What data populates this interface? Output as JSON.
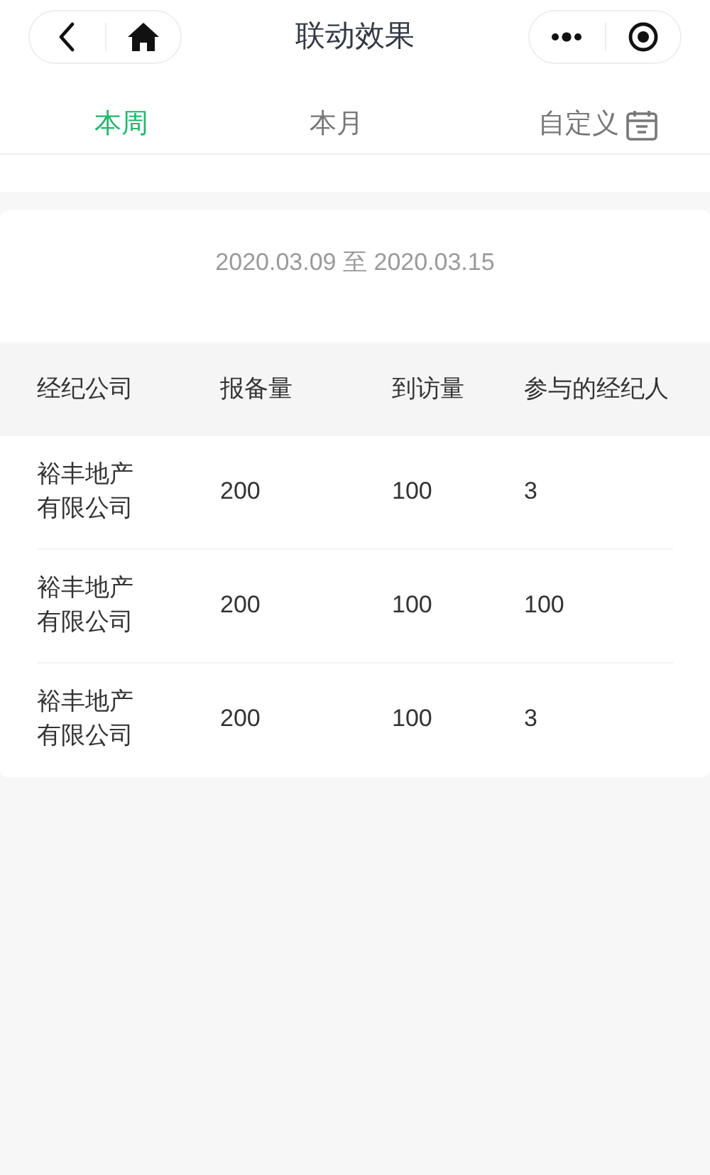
{
  "nav": {
    "title": "联动效果"
  },
  "tabs": [
    {
      "label": "本周",
      "selected": true,
      "kind": "text"
    },
    {
      "label": "本月",
      "selected": false,
      "kind": "text"
    },
    {
      "label": "自定义",
      "selected": false,
      "kind": "calendar"
    }
  ],
  "date_range": {
    "start": "2020.03.09",
    "separator": "至",
    "end": "2020.03.15"
  },
  "table": {
    "columns": [
      "经纪公司",
      "报备量",
      "到访量",
      "参与的经纪人"
    ],
    "rows": [
      [
        "裕丰地产有限公司",
        "200",
        "100",
        "3"
      ],
      [
        "裕丰地产有限公司",
        "200",
        "100",
        "100"
      ],
      [
        "裕丰地产有限公司",
        "200",
        "100",
        "3"
      ]
    ]
  }
}
